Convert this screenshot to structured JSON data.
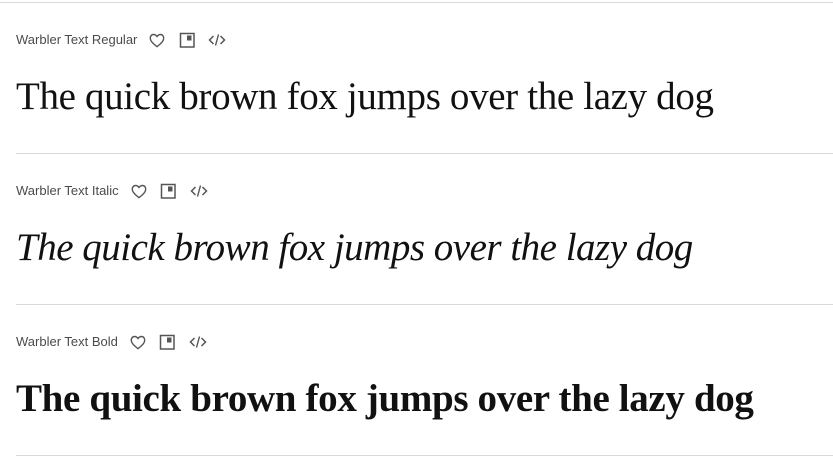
{
  "fonts": [
    {
      "name": "Warbler Text Regular",
      "sample": "The quick brown fox jumps over the lazy dog",
      "icons": [
        "heart-icon",
        "copy-icon",
        "code-icon"
      ]
    },
    {
      "name": "Warbler Text Italic",
      "sample": "The quick brown fox jumps over the lazy dog",
      "icons": [
        "heart-icon",
        "copy-icon",
        "code-icon"
      ]
    },
    {
      "name": "Warbler Text Bold",
      "sample": "The quick brown fox jumps over the lazy dog",
      "icons": [
        "heart-icon",
        "copy-icon",
        "code-icon"
      ]
    }
  ],
  "colors": {
    "text": "#111111",
    "meta": "#4b4b4b",
    "divider": "#d9d9d9",
    "icon": "#555555"
  }
}
